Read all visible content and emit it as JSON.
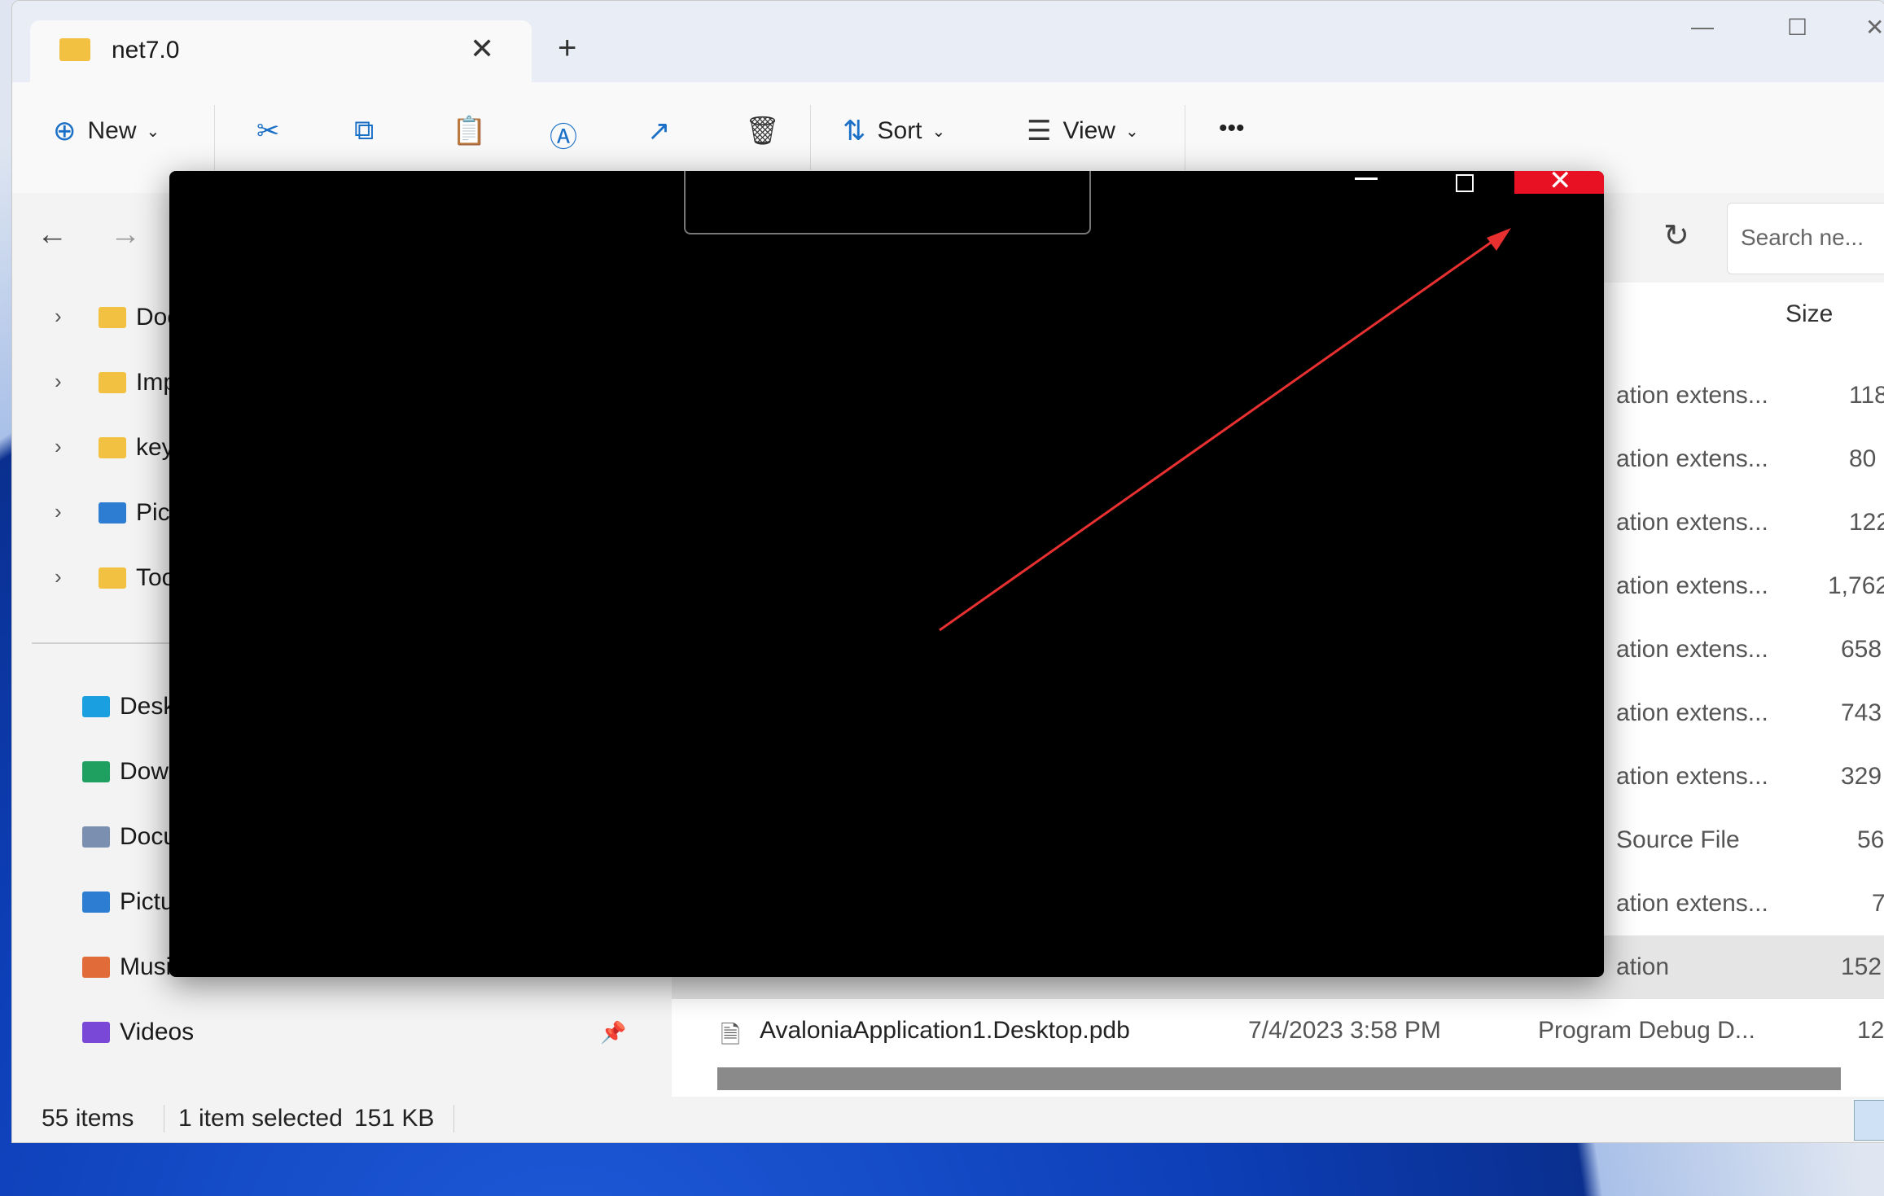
{
  "tab": {
    "title": "net7.0",
    "close": "✕",
    "new_tab": "+"
  },
  "window_controls": {
    "minimize": "—",
    "maximize": "☐",
    "close": "✕"
  },
  "toolbar": {
    "new_label": "New",
    "sort_label": "Sort",
    "view_label": "View",
    "more": "•••"
  },
  "search": {
    "placeholder": "Search ne..."
  },
  "sidebar": {
    "tree": [
      "Doc",
      "Imp",
      "key",
      "Pict",
      "Too"
    ],
    "quick": [
      "Desk",
      "Dow",
      "Docu",
      "Pictu",
      "Musi",
      "Videos"
    ]
  },
  "columns": {
    "size": "Size"
  },
  "files": [
    {
      "type": "ation extens...",
      "size": "118 |"
    },
    {
      "type": "ation extens...",
      "size": "80 |"
    },
    {
      "type": "ation extens...",
      "size": "122 |"
    },
    {
      "type": "ation extens...",
      "size": "1,762 |"
    },
    {
      "type": "ation extens...",
      "size": "658 |"
    },
    {
      "type": "ation extens...",
      "size": "743 |"
    },
    {
      "type": "ation extens...",
      "size": "329 |"
    },
    {
      "type": "Source File",
      "size": "56 |"
    },
    {
      "type": "ation extens...",
      "size": "7 |"
    },
    {
      "type": "ation",
      "size": "152 |"
    }
  ],
  "last_file": {
    "name": "AvaloniaApplication1.Desktop.pdb",
    "date": "7/4/2023 3:58 PM",
    "type": "Program Debug D...",
    "size": "12 |"
  },
  "status": {
    "items": "55 items",
    "selected": "1 item selected",
    "size": "151 KB"
  },
  "colors": {
    "accent": "#1a6fc7",
    "close_red": "#e81123",
    "arrow": "#e83030"
  }
}
